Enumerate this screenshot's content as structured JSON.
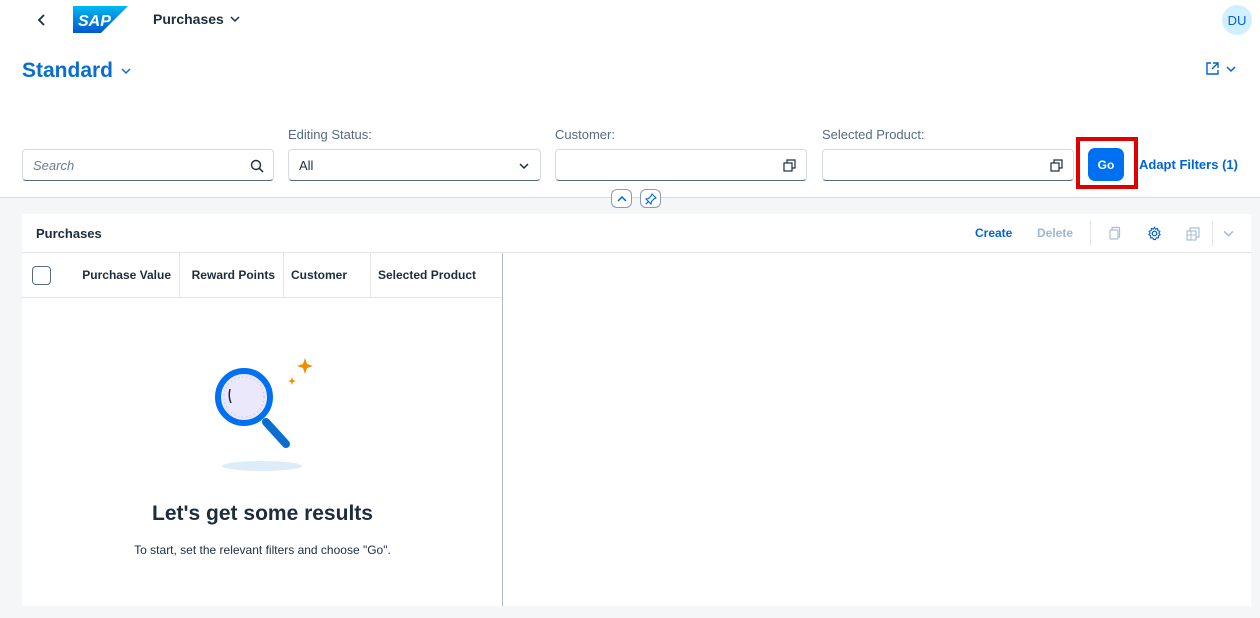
{
  "shell": {
    "logo_text": "SAP",
    "app_title": "Purchases",
    "avatar_initials": "DU"
  },
  "header": {
    "variant_name": "Standard"
  },
  "filters": {
    "search_placeholder": "Search",
    "editing_status_label": "Editing Status:",
    "editing_status_value": "All",
    "customer_label": "Customer:",
    "customer_value": "",
    "selected_product_label": "Selected Product:",
    "selected_product_value": "",
    "go_label": "Go",
    "adapt_filters_label": "Adapt Filters (1)"
  },
  "table": {
    "title": "Purchases",
    "create_label": "Create",
    "delete_label": "Delete",
    "columns": [
      "Purchase Value",
      "Reward Points",
      "Customer",
      "Selected Product"
    ],
    "rows": [],
    "empty_title": "Let's get some results",
    "empty_description": "To start, set the relevant filters and choose \"Go\"."
  },
  "colors": {
    "brand": "#0070f2",
    "highlight": "#e00000",
    "link": "#0064d9"
  }
}
